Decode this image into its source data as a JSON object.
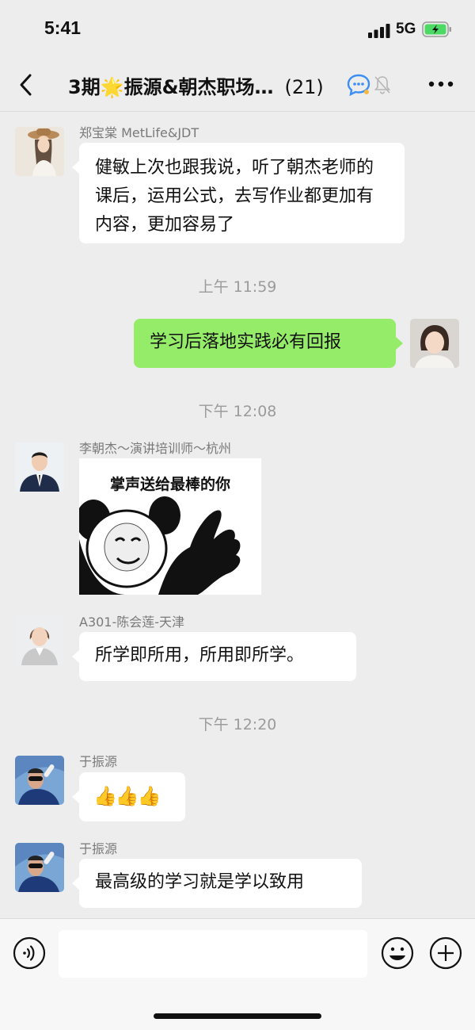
{
  "status": {
    "time": "5:41",
    "network": "5G"
  },
  "nav": {
    "title_prefix": "3期",
    "title_star": "🌟",
    "title_main": "振源&朝杰职场…",
    "member_count": "(21)"
  },
  "messages": [
    {
      "sender": "郑宝棠 MetLife&JDT",
      "text": "健敏上次也跟我说，听了朝杰老师的课后，运用公式，去写作业都更加有内容，更加容易了"
    },
    {
      "timestamp": "上午 11:59"
    },
    {
      "self": true,
      "text": "学习后落地实践必有回报"
    },
    {
      "timestamp": "下午 12:08"
    },
    {
      "sender": "李朝杰～演讲培训师～杭州",
      "sticker_text": "掌声送给最棒的你"
    },
    {
      "sender": "A301-陈会莲-天津",
      "text": "所学即所用，所用即所学。"
    },
    {
      "timestamp": "下午 12:20"
    },
    {
      "sender": "于振源",
      "text": "👍👍👍"
    },
    {
      "sender": "于振源",
      "text": "最高级的学习就是学以致用"
    }
  ],
  "colors": {
    "self_bubble": "#95ec69",
    "background": "#ededed"
  },
  "icons": [
    "back-icon",
    "chat-bubble-icon",
    "mute-bell-icon",
    "more-icon",
    "voice-icon",
    "emoji-icon",
    "plus-icon"
  ]
}
